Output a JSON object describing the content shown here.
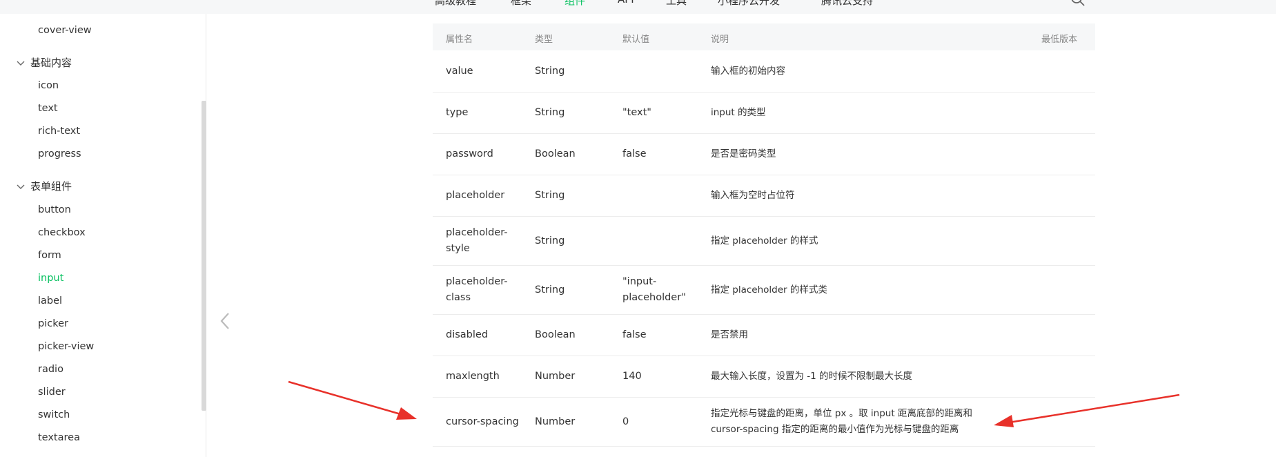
{
  "nav": {
    "items": [
      {
        "label": "高级教程",
        "active": false
      },
      {
        "label": "框架",
        "active": false
      },
      {
        "label": "组件",
        "active": true
      },
      {
        "label": "API",
        "active": false
      },
      {
        "label": "工具",
        "active": false
      },
      {
        "label": "小程序云开发",
        "active": false
      },
      {
        "label": "腾讯云支持",
        "active": false
      }
    ],
    "search_icon": "search-icon"
  },
  "sidebar": {
    "top_item": "cover-view",
    "groups": [
      {
        "title": "基础内容",
        "items": [
          "icon",
          "text",
          "rich-text",
          "progress"
        ]
      },
      {
        "title": "表单组件",
        "items": [
          "button",
          "checkbox",
          "form",
          "input",
          "label",
          "picker",
          "picker-view",
          "radio",
          "slider",
          "switch",
          "textarea"
        ]
      }
    ],
    "active_item": "input"
  },
  "table": {
    "headers": {
      "name": "属性名",
      "type": "类型",
      "default": "默认值",
      "desc": "说明",
      "version": "最低版本"
    },
    "rows": [
      {
        "name": "value",
        "type": "String",
        "default": "",
        "desc": "输入框的初始内容"
      },
      {
        "name": "type",
        "type": "String",
        "default": "\"text\"",
        "desc": "input 的类型"
      },
      {
        "name": "password",
        "type": "Boolean",
        "default": "false",
        "desc": "是否是密码类型"
      },
      {
        "name": "placeholder",
        "type": "String",
        "default": "",
        "desc": "输入框为空时占位符"
      },
      {
        "name": "placeholder-style",
        "type": "String",
        "default": "",
        "desc": "指定 placeholder 的样式"
      },
      {
        "name": "placeholder-class",
        "type": "String",
        "default": "\"input-placeholder\"",
        "desc": "指定 placeholder 的样式类"
      },
      {
        "name": "disabled",
        "type": "Boolean",
        "default": "false",
        "desc": "是否禁用"
      },
      {
        "name": "maxlength",
        "type": "Number",
        "default": "140",
        "desc": "最大输入长度，设置为 -1 的时候不限制最大长度"
      },
      {
        "name": "cursor-spacing",
        "type": "Number",
        "default": "0",
        "desc": "指定光标与键盘的距离，单位 px 。取 input 距离底部的距离和 cursor-spacing 指定的距离的最小值作为光标与键盘的距离"
      }
    ]
  },
  "colors": {
    "accent": "#07c160",
    "arrow": "#e8312a",
    "header_bg": "#f6f7f8"
  }
}
